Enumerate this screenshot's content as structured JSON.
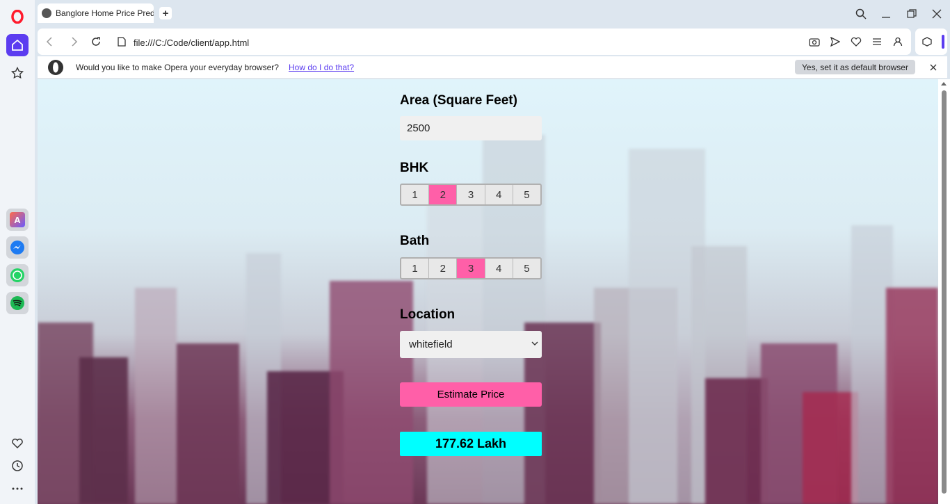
{
  "browser": {
    "tab_title": "Banglore Home Price Pred",
    "url": "file:///C:/Code/client/app.html",
    "infobar_text": "Would you like to make Opera your everyday browser?",
    "infobar_link": "How do I do that?",
    "infobar_button": "Yes, set it as default browser"
  },
  "form": {
    "area_label": "Area (Square Feet)",
    "area_value": "2500",
    "bhk_label": "BHK",
    "bhk_options": [
      "1",
      "2",
      "3",
      "4",
      "5"
    ],
    "bhk_selected": "2",
    "bath_label": "Bath",
    "bath_options": [
      "1",
      "2",
      "3",
      "4",
      "5"
    ],
    "bath_selected": "3",
    "location_label": "Location",
    "location_value": "whitefield",
    "estimate_button": "Estimate Price",
    "result": "177.62 Lakh"
  },
  "colors": {
    "accent": "#ff5fa8",
    "result_bg": "#00ffff",
    "opera_red": "#ff1b2d",
    "sidebar_active": "#5b3cf0"
  }
}
